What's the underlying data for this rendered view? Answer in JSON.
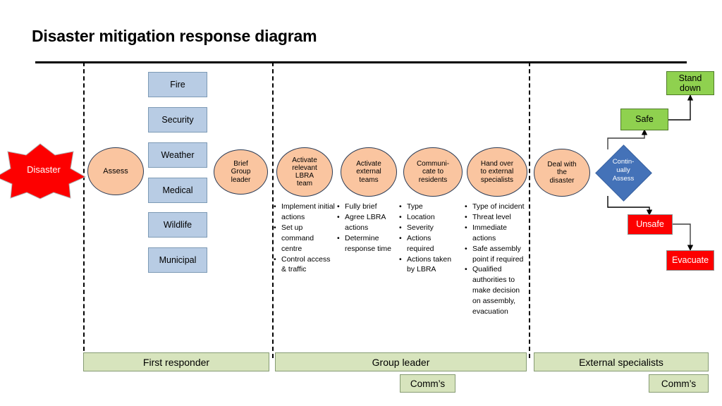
{
  "title": "Disaster mitigation response diagram",
  "start": {
    "label": "Disaster",
    "color": "#FF0000"
  },
  "colors": {
    "blue_box": "#B8CCE4",
    "ellipse": "#FAC5A0",
    "diamond": "#4472B8",
    "safe_green": "#8FD14F",
    "unsafe_red": "#FD0000",
    "lane_bar": "#D7E4BD"
  },
  "first_responder_categories": [
    {
      "label": "Fire"
    },
    {
      "label": "Security"
    },
    {
      "label": "Weather"
    },
    {
      "label": "Medical"
    },
    {
      "label": "Wildlife"
    },
    {
      "label": "Municipal"
    }
  ],
  "process_steps": [
    {
      "id": "assess",
      "lines": [
        "Assess"
      ],
      "bullets": []
    },
    {
      "id": "brief-group-leader",
      "lines": [
        "Brief",
        "Group",
        "leader"
      ],
      "bullets": []
    },
    {
      "id": "activate-relevant-lbra-team",
      "lines": [
        "Activate",
        "relevant",
        "LBRA",
        "team"
      ],
      "bullets": [
        "Implement initial actions",
        "Set up command centre",
        "Control access & traffic"
      ]
    },
    {
      "id": "activate-external-teams",
      "lines": [
        "Activate",
        "external",
        "teams"
      ],
      "bullets": [
        "Fully brief",
        "Agree LBRA actions",
        "Determine response time"
      ]
    },
    {
      "id": "communicate-to-residents",
      "lines": [
        "Communi-",
        "cate to",
        "residents"
      ],
      "bullets": [
        "Type",
        "Location",
        "Severity",
        "Actions required",
        "Actions taken by LBRA"
      ]
    },
    {
      "id": "hand-over-to-external-specialists",
      "lines": [
        "Hand over",
        "to external",
        "specialists"
      ],
      "bullets": [
        "Type of incident",
        "Threat level",
        "Immediate actions",
        "Safe assembly point if required",
        "Qualified authorities to make decision on assembly, evacuation"
      ]
    },
    {
      "id": "deal-with-the-disaster",
      "lines": [
        "Deal with",
        "the",
        "disaster"
      ],
      "bullets": []
    }
  ],
  "decision": {
    "lines": [
      "Contin-",
      "ually",
      "Assess"
    ]
  },
  "outcomes": {
    "safe": "Safe",
    "stand_down": "Stand down",
    "stand_down_lines": [
      "Stand",
      "down"
    ],
    "unsafe": "Unsafe",
    "evacuate": "Evacuate"
  },
  "lanes": [
    {
      "label": "First responder"
    },
    {
      "label": "Group leader"
    },
    {
      "label": "External specialists"
    }
  ],
  "comms": [
    {
      "label": "Comm’s"
    },
    {
      "label": "Comm’s"
    }
  ]
}
